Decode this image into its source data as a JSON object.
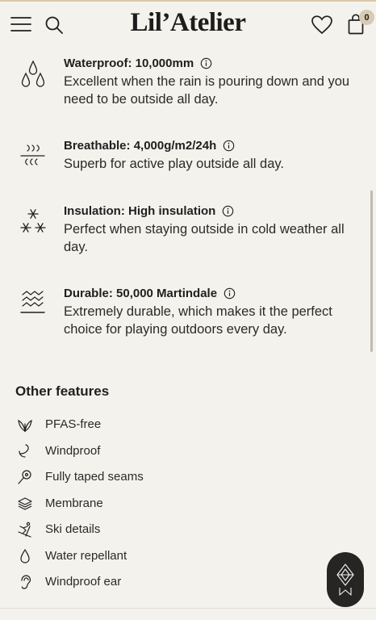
{
  "header": {
    "brand": "Lil’Atelier",
    "cart_count": "0",
    "icons": [
      "menu-icon",
      "search-icon",
      "heart-icon",
      "bag-icon"
    ]
  },
  "specs": [
    {
      "icon": "waterproof-drops-icon",
      "title": "Waterproof: 10,000mm",
      "description": "Excellent when the rain is pouring down and you need to be outside all day."
    },
    {
      "icon": "breathable-icon",
      "title": "Breathable: 4,000g/m2/24h",
      "description": "Superb for active play outside all day."
    },
    {
      "icon": "snowflake-icon",
      "title": "Insulation: High insulation",
      "description": "Perfect when staying outside in cold weather all day."
    },
    {
      "icon": "durable-icon",
      "title": "Durable: 50,000 Martindale",
      "description": "Extremely durable, which makes it the perfect choice for playing outdoors every day."
    }
  ],
  "other_features": {
    "title": "Other features",
    "items": [
      {
        "icon": "leaf-icon",
        "label": "PFAS-free"
      },
      {
        "icon": "wind-icon",
        "label": "Windproof"
      },
      {
        "icon": "seam-icon",
        "label": "Fully taped seams"
      },
      {
        "icon": "layers-icon",
        "label": "Membrane"
      },
      {
        "icon": "skier-icon",
        "label": "Ski details"
      },
      {
        "icon": "droplet-icon",
        "label": "Water repellant"
      },
      {
        "icon": "ear-icon",
        "label": "Windproof ear"
      }
    ]
  },
  "colors": {
    "background": "#f4f2ec",
    "text": "#1f1f1f",
    "badge": "#d8cbb3",
    "chat_button": "#262523"
  }
}
